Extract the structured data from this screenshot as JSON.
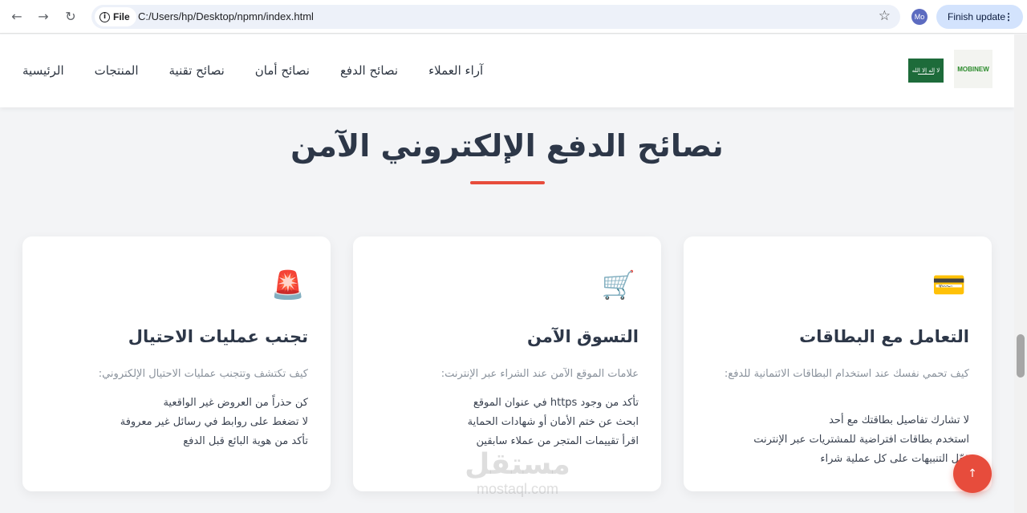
{
  "browser": {
    "chip_label": "File",
    "url": "C:/Users/hp/Desktop/npmn/index.html",
    "avatar": "Mo",
    "finish_update": "Finish update"
  },
  "header": {
    "menu": [
      "الرئيسية",
      "المنتجات",
      "نصائح تقنية",
      "نصائح أمان",
      "نصائح الدفع",
      "آراء العملاء"
    ],
    "logo_text": "MOBINEW",
    "flag_text": "لا إله إلا الله"
  },
  "section": {
    "title": "نصائح الدفع الإلكتروني الآمن"
  },
  "cards": [
    {
      "icon": "credit-card-icon",
      "icon_glyph": "💳",
      "title": "التعامل مع البطاقات",
      "intro": "كيف تحمي نفسك عند استخدام البطاقات الائتمانية للدفع:",
      "items": [
        "لا تشارك تفاصيل بطاقتك مع أحد",
        "استخدم بطاقات افتراضية للمشتريات عبر الإنترنت",
        "فعّل التنبيهات على كل عملية شراء"
      ]
    },
    {
      "icon": "shopping-cart-icon",
      "icon_glyph": "🛒",
      "title": "التسوق الآمن",
      "intro": "علامات الموقع الآمن عند الشراء عبر الإنترنت:",
      "items": [
        "تأكد من وجود https في عنوان الموقع",
        "ابحث عن ختم الأمان أو شهادات الحماية",
        "اقرأ تقييمات المتجر من عملاء سابقين"
      ]
    },
    {
      "icon": "alarm-light-icon",
      "icon_glyph": "🚨",
      "title": "تجنب عمليات الاحتيال",
      "intro": "كيف تكتشف وتتجنب عمليات الاحتيال الإلكتروني:",
      "items": [
        "كن حذراً من العروض غير الواقعية",
        "لا تضغط على روابط في رسائل غير معروفة",
        "تأكد من هوية البائع قبل الدفع"
      ]
    }
  ],
  "watermark": {
    "arabic": "مستقل",
    "latin": "mostaql.com"
  },
  "to_top_glyph": "↑"
}
